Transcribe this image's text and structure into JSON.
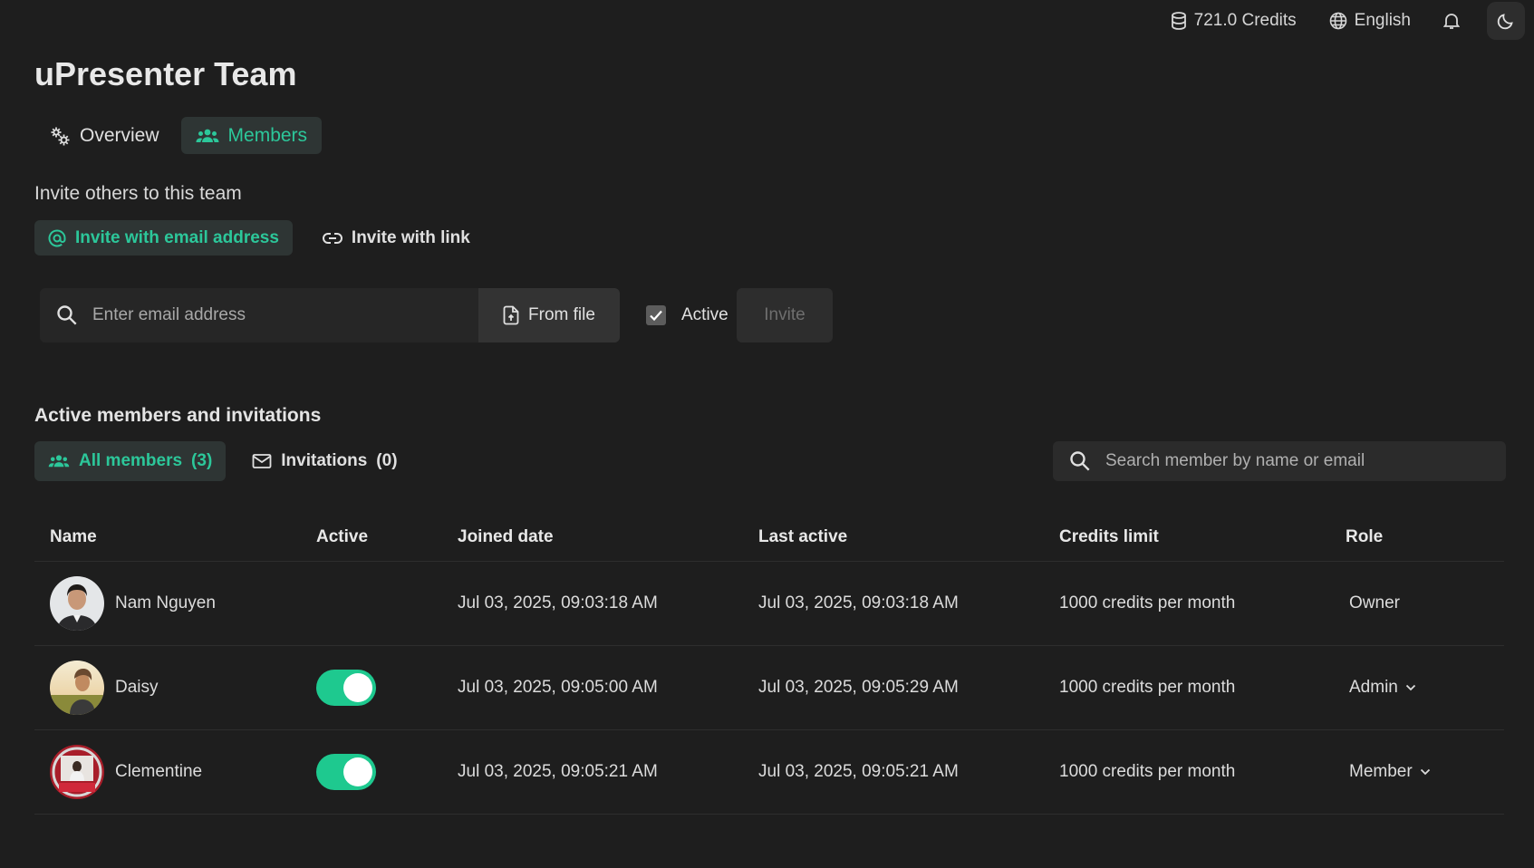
{
  "topbar": {
    "credits": "721.0 Credits",
    "language": "English",
    "icons": [
      "database-icon",
      "globe-icon",
      "bell-icon",
      "moon-icon"
    ]
  },
  "page": {
    "title": "uPresenter Team",
    "tabs": [
      {
        "label": "Overview",
        "icon": "gears-icon",
        "active": false
      },
      {
        "label": "Members",
        "icon": "users-icon",
        "active": true
      }
    ]
  },
  "invite": {
    "heading": "Invite others to this team",
    "modes": [
      {
        "label": "Invite with email address",
        "icon": "at-icon",
        "active": true
      },
      {
        "label": "Invite with link",
        "icon": "link-icon",
        "active": false
      }
    ],
    "email_placeholder": "Enter email address",
    "from_file_label": "From file",
    "active_label": "Active",
    "active_checked": true,
    "invite_label": "Invite"
  },
  "members": {
    "section_title": "Active members and invitations",
    "filters": [
      {
        "label": "All members",
        "count": "(3)",
        "active": true
      },
      {
        "label": "Invitations",
        "count": "(0)",
        "active": false
      }
    ],
    "search_placeholder": "Search member by name or email",
    "columns": [
      "Name",
      "Active",
      "Joined date",
      "Last active",
      "Credits limit",
      "Role"
    ],
    "rows": [
      {
        "name": "Nam Nguyen",
        "active": null,
        "joined": "Jul 03, 2025, 09:03:18 AM",
        "last_active": "Jul 03, 2025, 09:03:18 AM",
        "credits": "1000 credits per month",
        "role": "Owner",
        "role_editable": false
      },
      {
        "name": "Daisy",
        "active": true,
        "joined": "Jul 03, 2025, 09:05:00 AM",
        "last_active": "Jul 03, 2025, 09:05:29 AM",
        "credits": "1000 credits per month",
        "role": "Admin",
        "role_editable": true
      },
      {
        "name": "Clementine",
        "active": true,
        "joined": "Jul 03, 2025, 09:05:21 AM",
        "last_active": "Jul 03, 2025, 09:05:21 AM",
        "credits": "1000 credits per month",
        "role": "Member",
        "role_editable": true
      }
    ]
  },
  "colors": {
    "accent": "#2cc79a",
    "toggle_on": "#1ec98f",
    "background": "#1e1e1e"
  }
}
